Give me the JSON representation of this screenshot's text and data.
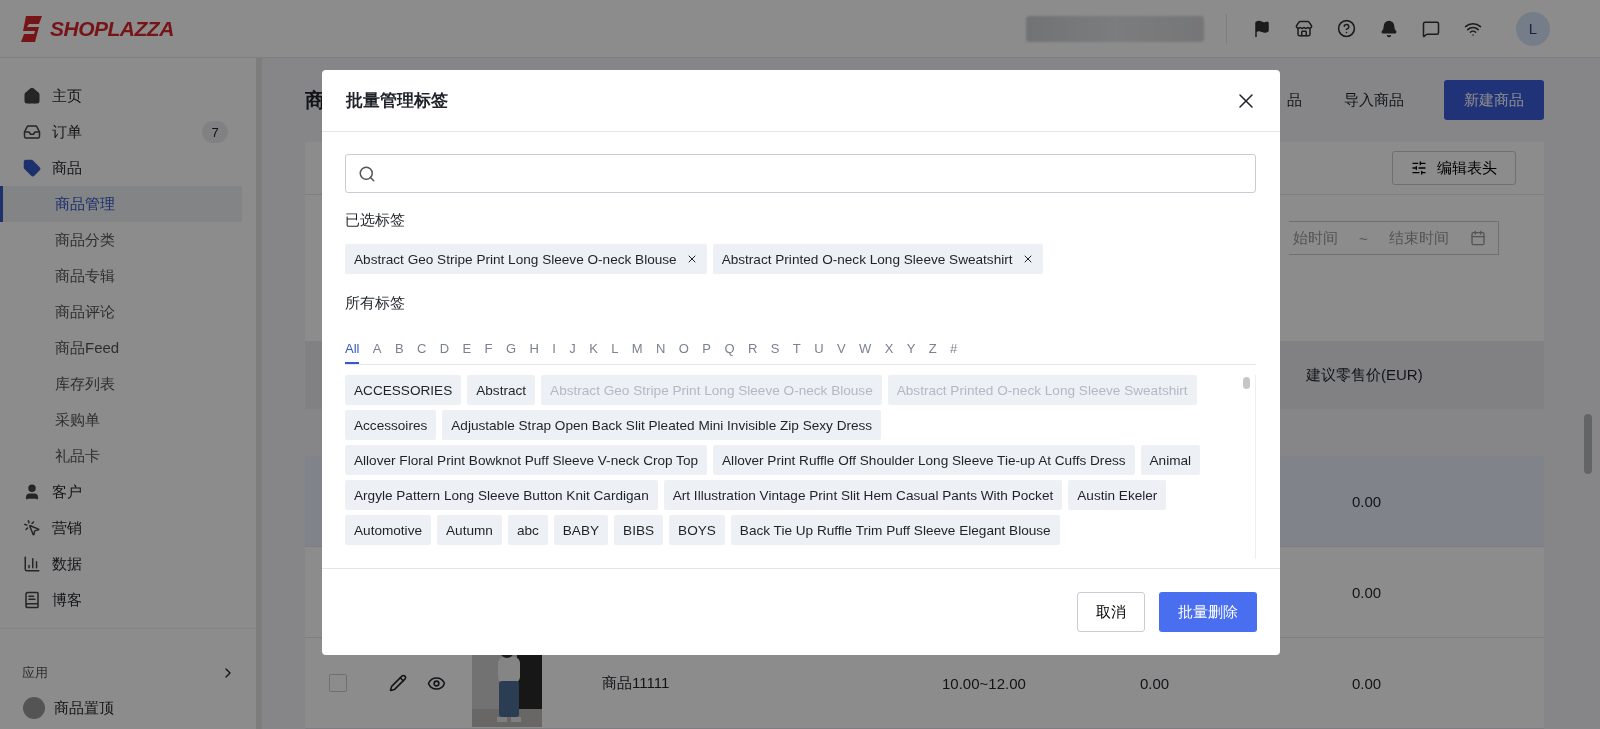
{
  "top_bar": {
    "logo": "SHOPLAZZA",
    "avatar": "L"
  },
  "sidebar": {
    "items": [
      {
        "label": "主页",
        "selected": false
      },
      {
        "label": "订单",
        "badge": "7",
        "selected": false
      },
      {
        "label": "商品",
        "selected": true,
        "expanded": true,
        "children": [
          {
            "label": "商品管理",
            "selected": true
          },
          {
            "label": "商品分类",
            "selected": false
          },
          {
            "label": "商品专辑",
            "selected": false
          },
          {
            "label": "商品评论",
            "selected": false
          },
          {
            "label": "商品Feed",
            "selected": false
          },
          {
            "label": "库存列表",
            "selected": false
          },
          {
            "label": "采购单",
            "selected": false
          },
          {
            "label": "礼品卡",
            "selected": false
          }
        ]
      },
      {
        "label": "客户",
        "selected": false
      },
      {
        "label": "营销",
        "selected": false
      },
      {
        "label": "数据",
        "selected": false
      },
      {
        "label": "博客",
        "selected": false
      }
    ],
    "apps_heading": "应用",
    "apps": [
      {
        "label": "商品置顶"
      }
    ]
  },
  "main": {
    "page_title": "商",
    "header_links": [
      "品",
      "导入商品"
    ],
    "primary_button": "新建商品",
    "edit_columns_button": "编辑表头",
    "date_range": {
      "start": "始时间",
      "separator": "~",
      "end": "结束时间"
    },
    "table": {
      "columns": [
        "建议零售价(EUR)"
      ],
      "rows": [
        {
          "kind": "partial",
          "highlighted": true,
          "price": "0.00"
        },
        {
          "kind": "partial",
          "highlighted": false,
          "price": "0.00"
        },
        {
          "kind": "product",
          "highlighted": false,
          "checked": false,
          "name": "商品11111",
          "price_range": "10.00~12.00",
          "column_3": "0.00",
          "price": "0.00"
        }
      ]
    }
  },
  "modal": {
    "title": "批量管理标签",
    "selected_heading": "已选标签",
    "selected_tags": [
      "Abstract Geo Stripe Print Long Sleeve O-neck Blouse",
      "Abstract Printed O-neck Long Sleeve Sweatshirt"
    ],
    "all_heading": "所有标签",
    "letters": [
      {
        "label": "All",
        "selected": true
      },
      {
        "label": "A",
        "selected": false
      },
      {
        "label": "B",
        "selected": false
      },
      {
        "label": "C",
        "selected": false
      },
      {
        "label": "D",
        "selected": false
      },
      {
        "label": "E",
        "selected": false
      },
      {
        "label": "F",
        "selected": false
      },
      {
        "label": "G",
        "selected": false
      },
      {
        "label": "H",
        "selected": false
      },
      {
        "label": "I",
        "selected": false
      },
      {
        "label": "J",
        "selected": false
      },
      {
        "label": "K",
        "selected": false
      },
      {
        "label": "L",
        "selected": false
      },
      {
        "label": "M",
        "selected": false
      },
      {
        "label": "N",
        "selected": false
      },
      {
        "label": "O",
        "selected": false
      },
      {
        "label": "P",
        "selected": false
      },
      {
        "label": "Q",
        "selected": false
      },
      {
        "label": "R",
        "selected": false
      },
      {
        "label": "S",
        "selected": false
      },
      {
        "label": "T",
        "selected": false
      },
      {
        "label": "U",
        "selected": false
      },
      {
        "label": "V",
        "selected": false
      },
      {
        "label": "W",
        "selected": false
      },
      {
        "label": "X",
        "selected": false
      },
      {
        "label": "Y",
        "selected": false
      },
      {
        "label": "Z",
        "selected": false
      },
      {
        "label": "#",
        "selected": false
      }
    ],
    "tags": [
      {
        "label": "ACCESSORIES",
        "disabled": false
      },
      {
        "label": "Abstract",
        "disabled": false
      },
      {
        "label": "Abstract Geo Stripe Print Long Sleeve O-neck Blouse",
        "disabled": true
      },
      {
        "label": "Abstract Printed O-neck Long Sleeve Sweatshirt",
        "disabled": true
      },
      {
        "label": "Accessoires",
        "disabled": false
      },
      {
        "label": "Adjustable Strap Open Back Slit Pleated Mini Invisible Zip Sexy Dress",
        "disabled": false
      },
      {
        "label": "Allover Floral Print Bowknot Puff Sleeve V-neck Crop Top",
        "disabled": false
      },
      {
        "label": "Allover Print Ruffle Off Shoulder Long Sleeve Tie-up At Cuffs Dress",
        "disabled": false
      },
      {
        "label": "Animal",
        "disabled": false
      },
      {
        "label": "Argyle Pattern Long Sleeve Button Knit Cardigan",
        "disabled": false
      },
      {
        "label": "Art Illustration Vintage Print Slit Hem Casual Pants With Pocket",
        "disabled": false
      },
      {
        "label": "Austin Ekeler",
        "disabled": false
      },
      {
        "label": "Automotive",
        "disabled": false
      },
      {
        "label": "Autumn",
        "disabled": false
      },
      {
        "label": "abc",
        "disabled": false
      },
      {
        "label": "BABY",
        "disabled": false
      },
      {
        "label": "BIBS",
        "disabled": false
      },
      {
        "label": "BOYS",
        "disabled": false
      },
      {
        "label": "Back Tie Up Ruffle Trim Puff Sleeve Elegant Blouse",
        "disabled": false
      }
    ],
    "cancel_button": "取消",
    "confirm_button": "批量删除"
  }
}
